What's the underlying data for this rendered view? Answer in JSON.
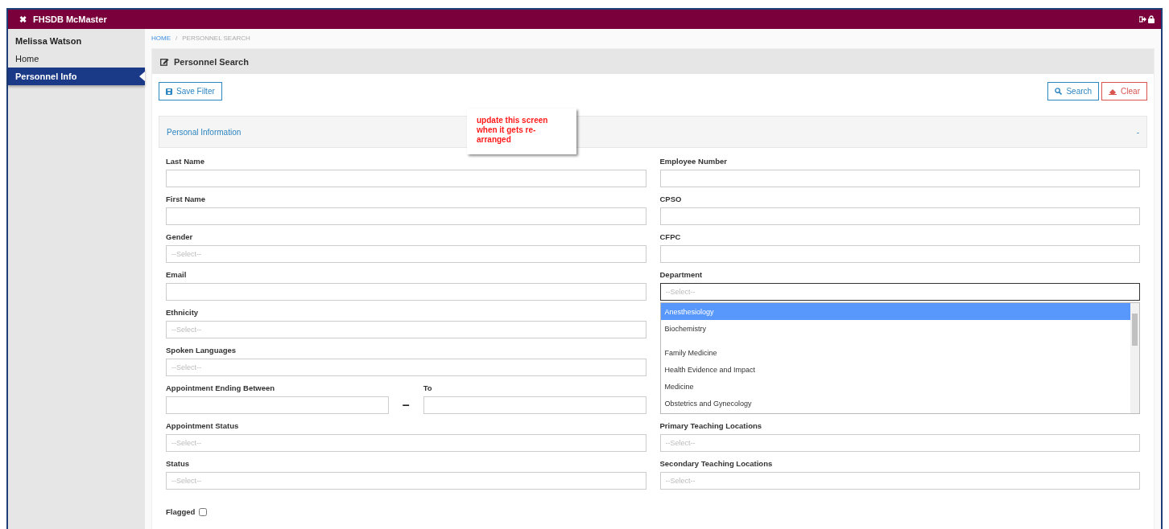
{
  "app_bar": {
    "close_glyph": "✖",
    "title": "FHSDB McMaster"
  },
  "sidebar": {
    "user": "Melissa Watson",
    "items": [
      {
        "label": "Home",
        "selected": false
      },
      {
        "label": "Personnel Info",
        "selected": true
      }
    ]
  },
  "breadcrumb": [
    "HOME",
    "/",
    "PERSONNEL SEARCH"
  ],
  "panel": {
    "title": "Personnel Search",
    "buttons": [
      {
        "kind": "save",
        "label": "Save Filter"
      },
      {
        "kind": "search",
        "label": "Search"
      },
      {
        "kind": "clear",
        "label": "Clear"
      }
    ],
    "section": {
      "title": "Personal Information",
      "collapse_glyph": "-",
      "expanded": true
    },
    "note": "update this screen when it gets re-arranged",
    "left_fields": [
      {
        "kind": "text",
        "label": "Last Name"
      },
      {
        "kind": "text",
        "label": "First Name"
      },
      {
        "kind": "select",
        "label": "Gender",
        "placeholder": "--Select--"
      },
      {
        "kind": "text",
        "label": "Email"
      },
      {
        "kind": "select",
        "label": "Ethnicity",
        "placeholder": "--Select--"
      },
      {
        "kind": "select",
        "label": "Spoken Languages",
        "placeholder": "--Select--"
      },
      {
        "kind": "range",
        "label": "Appointment Ending Between",
        "separator": "–",
        "to_label": "To"
      },
      {
        "kind": "select",
        "label": "Appointment Status",
        "placeholder": "--Select--"
      },
      {
        "kind": "select",
        "label": "Status",
        "placeholder": "--Select--"
      }
    ],
    "flagged": {
      "label": "Flagged",
      "checked": false
    },
    "right_fields": [
      {
        "kind": "text",
        "label": "Employee Number"
      },
      {
        "kind": "text",
        "label": "CPSO"
      },
      {
        "kind": "text",
        "label": "CFPC"
      },
      {
        "kind": "dropdown",
        "label": "Department",
        "placeholder": "--Select--",
        "options": [
          {
            "label": "Anesthesiology",
            "selected": true
          },
          {
            "label": "Biochemistry",
            "selected": false
          },
          {
            "kind": "blank",
            "selected": false
          },
          {
            "label": "Family Medicine",
            "selected": false
          },
          {
            "label": "Health Evidence and Impact",
            "selected": false
          },
          {
            "label": "Medicine",
            "selected": false
          },
          {
            "label": "Obstetrics and Gynecology",
            "selected": false
          }
        ]
      },
      {
        "kind": "select",
        "label": "Primary Teaching Locations",
        "placeholder": "--Select--"
      },
      {
        "kind": "select",
        "label": "Secondary Teaching Locations",
        "placeholder": "--Select--"
      }
    ]
  }
}
